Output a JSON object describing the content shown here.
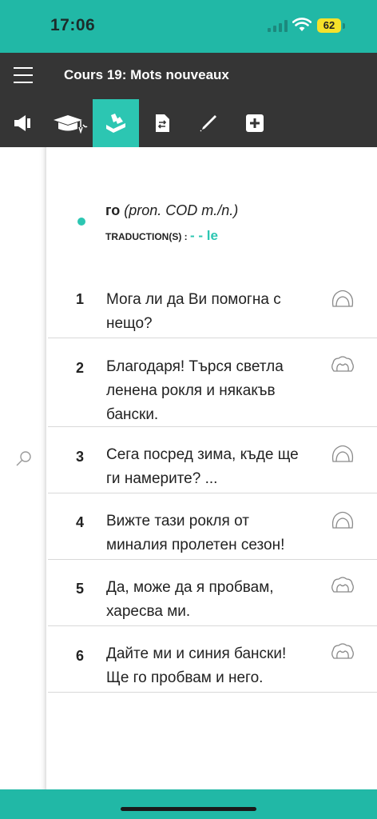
{
  "status_bar": {
    "time": "17:06",
    "battery": "62"
  },
  "header": {
    "title": "Cours 19: Mots nouveaux"
  },
  "toolbar": {
    "tools": [
      {
        "icon": "speaker-icon"
      },
      {
        "icon": "graduation-cap-icon"
      },
      {
        "icon": "flashcard-icon",
        "active": true
      },
      {
        "icon": "translate-document-icon"
      },
      {
        "icon": "pencil-icon"
      },
      {
        "icon": "add-icon"
      }
    ]
  },
  "word": {
    "term": "го",
    "grammar": "(pron. COD m./n.)",
    "translation_label": "TRADUCTION(S) :",
    "translation_value": "- - le"
  },
  "sentences": [
    {
      "num": "1",
      "line1": "Мога ли да Ви помогна с",
      "line2": "нещо?",
      "line3": ""
    },
    {
      "num": "2",
      "line1": "Благодаря! Търся светла",
      "line2": "ленена рокля и някакъв",
      "line3": "бански."
    },
    {
      "num": "3",
      "line1": "Сега посред зима, къде ще",
      "line2": "ги намерите? ...",
      "line3": ""
    },
    {
      "num": "4",
      "line1": "Вижте тази рокля от",
      "line2": "миналия пролетен сезон!",
      "line3": ""
    },
    {
      "num": "5",
      "line1": "Да, може да я пробвам,",
      "line2": "харесва ми.",
      "line3": ""
    },
    {
      "num": "6",
      "line1": "Дайте ми и синия бански!",
      "line2": "Ще го пробвам и него.",
      "line3": ""
    }
  ],
  "colors": {
    "accent": "#2cc6b2",
    "status_bar": "#21b8a6",
    "header": "#353535"
  }
}
